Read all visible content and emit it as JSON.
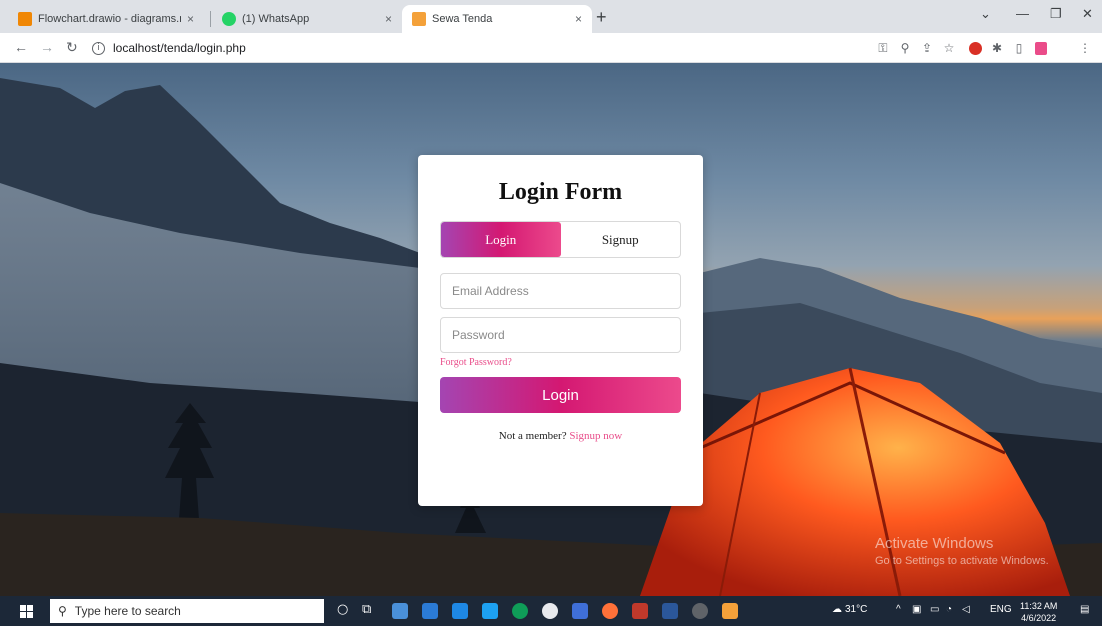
{
  "browser": {
    "tabs": [
      {
        "label": "Flowchart.drawio - diagrams.net",
        "favicon_color": "#f08705",
        "active": false
      },
      {
        "label": "(1) WhatsApp",
        "favicon_color": "#25d366",
        "active": false
      },
      {
        "label": "Sewa Tenda",
        "favicon_color": "#f4a13a",
        "active": true
      }
    ],
    "tab_close": "×",
    "new_tab": "+",
    "url": "localhost/tenda/login.php",
    "info_glyph": "i"
  },
  "login": {
    "title": "Login Form",
    "tab_login": "Login",
    "tab_signup": "Signup",
    "email_placeholder": "Email Address",
    "password_placeholder": "Password",
    "forgot": "Forgot Password?",
    "button": "Login",
    "member_text": "Not a member?",
    "signup_link": "Signup now",
    "accent_start": "#a445b2",
    "accent_end": "#ec4a8c"
  },
  "watermark": {
    "line1": "Activate Windows",
    "line2": "Go to Settings to activate Windows."
  },
  "taskbar": {
    "search_placeholder": "Type here to search",
    "weather": "31°C",
    "language": "ENG",
    "time": "11:32 AM",
    "date": "4/6/2022"
  }
}
